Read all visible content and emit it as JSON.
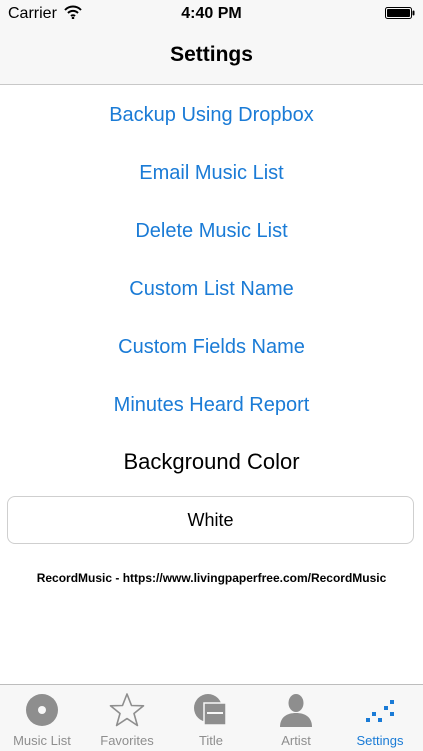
{
  "status_bar": {
    "carrier": "Carrier",
    "time": "4:40 PM"
  },
  "nav": {
    "title": "Settings"
  },
  "menu": [
    {
      "label": "Backup Using Dropbox"
    },
    {
      "label": "Email Music List"
    },
    {
      "label": "Delete Music List"
    },
    {
      "label": "Custom List Name"
    },
    {
      "label": "Custom Fields Name"
    },
    {
      "label": "Minutes Heard Report"
    }
  ],
  "background_color": {
    "label": "Background Color",
    "value": "White"
  },
  "footer": {
    "text": "RecordMusic - https://www.livingpaperfree.com/RecordMusic"
  },
  "tabs": [
    {
      "label": "Music List",
      "icon": "record-icon"
    },
    {
      "label": "Favorites",
      "icon": "star-icon"
    },
    {
      "label": "Title",
      "icon": "title-icon"
    },
    {
      "label": "Artist",
      "icon": "person-icon"
    },
    {
      "label": "Settings",
      "icon": "settings-icon",
      "active": true
    }
  ],
  "colors": {
    "accent": "#1a7bd6",
    "bar_bg": "#f7f7f7",
    "inactive_icon": "#8e8e8e"
  }
}
